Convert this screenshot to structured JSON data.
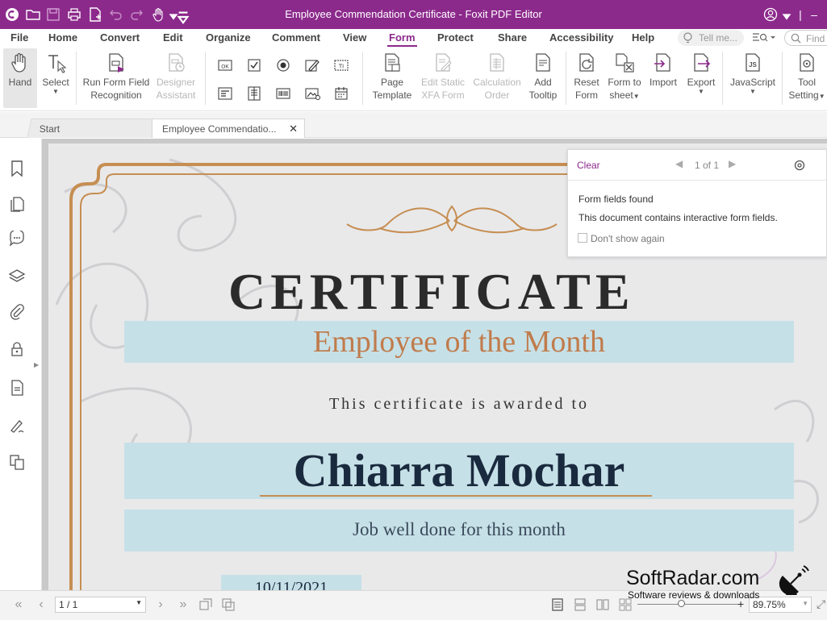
{
  "window": {
    "title": "Employee Commendation Certificate - Foxit PDF Editor"
  },
  "menubar": {
    "items": [
      "File",
      "Home",
      "Convert",
      "Edit",
      "Organize",
      "Comment",
      "View",
      "Form",
      "Protect",
      "Share",
      "Accessibility",
      "Help"
    ],
    "active": "Form",
    "tell_me_placeholder": "Tell me...",
    "find_placeholder": "Find"
  },
  "ribbon": {
    "hand": "Hand",
    "select": "Select",
    "run_form_1": "Run Form Field",
    "run_form_2": "Recognition",
    "designer_1": "Designer",
    "designer_2": "Assistant",
    "page_template_1": "Page",
    "page_template_2": "Template",
    "edit_static_1": "Edit Static",
    "edit_static_2": "XFA Form",
    "calc_1": "Calculation",
    "calc_2": "Order",
    "add_tooltip_1": "Add",
    "add_tooltip_2": "Tooltip",
    "reset_1": "Reset",
    "reset_2": "Form",
    "form_to_1": "Form to",
    "form_to_2": "sheet",
    "import": "Import",
    "export": "Export",
    "javascript": "JavaScript",
    "tool_1": "Tool",
    "tool_2": "Setting",
    "ok_icon_label": "OK",
    "ti_icon_label": "TI",
    "js_icon_label": "JS"
  },
  "tabs": {
    "start": "Start",
    "document": "Employee Commendatio..."
  },
  "certificate": {
    "heading": "CERTIFICATE",
    "subtitle": "Employee of the Month",
    "awarded": "This certificate is awarded to",
    "recipient": "Chiarra Mochar",
    "message": "Job well done for this month",
    "date": "10/11/2021"
  },
  "popup": {
    "clear": "Clear",
    "counter": "1 of 1",
    "title": "Form fields found",
    "body": "This document contains interactive form fields.",
    "checkbox_label": "Don't show again",
    "checkbox_checked": false
  },
  "statusbar": {
    "page": "1 / 1",
    "zoom": "89.75%",
    "zoom_fraction": 0.44
  },
  "watermark": {
    "brand": "SoftRadar.com",
    "tagline": "Software reviews & downloads"
  },
  "colors": {
    "accent": "#8c2a8c",
    "band": "#c6e0e7",
    "gold": "#c68e52",
    "subtitle": "#c07b4b"
  }
}
